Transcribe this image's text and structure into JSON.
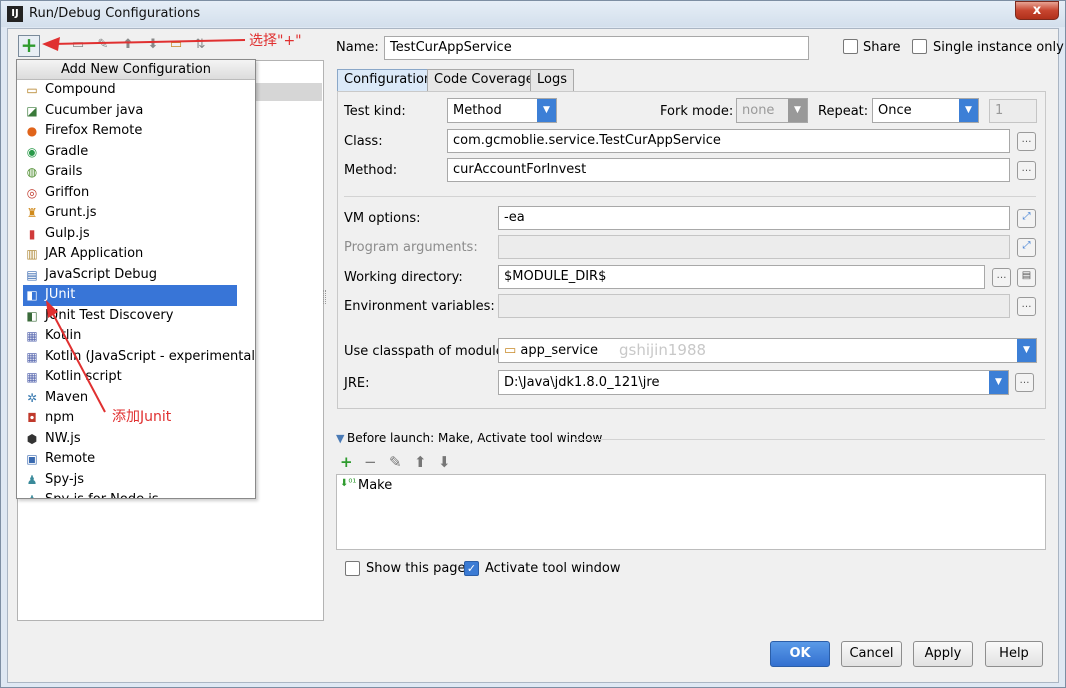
{
  "window": {
    "title": "Run/Debug Configurations",
    "close": "x",
    "logo": "IJ"
  },
  "toolbar": {
    "add": "+"
  },
  "popup": {
    "title": "Add New Configuration",
    "items": [
      {
        "label": "Compound",
        "icon": "compound-icon",
        "glyph": "▭",
        "color": "#b07b1c"
      },
      {
        "label": "Cucumber java",
        "icon": "cucumber-icon",
        "glyph": "◪",
        "color": "#3a7a3a"
      },
      {
        "label": "Firefox Remote",
        "icon": "firefox-icon",
        "glyph": "●",
        "color": "#e0641b"
      },
      {
        "label": "Gradle",
        "icon": "gradle-icon",
        "glyph": "◉",
        "color": "#2a9a4a"
      },
      {
        "label": "Grails",
        "icon": "grails-icon",
        "glyph": "◍",
        "color": "#4a8a2a"
      },
      {
        "label": "Griffon",
        "icon": "griffon-icon",
        "glyph": "◎",
        "color": "#c0392b"
      },
      {
        "label": "Grunt.js",
        "icon": "grunt-icon",
        "glyph": "♜",
        "color": "#d08a1c"
      },
      {
        "label": "Gulp.js",
        "icon": "gulp-icon",
        "glyph": "▮",
        "color": "#d03a3a"
      },
      {
        "label": "JAR Application",
        "icon": "jar-icon",
        "glyph": "▥",
        "color": "#b08a3a"
      },
      {
        "label": "JavaScript Debug",
        "icon": "js-debug-icon",
        "glyph": "▤",
        "color": "#3a6ab0"
      },
      {
        "label": "JUnit",
        "icon": "junit-icon",
        "glyph": "◧",
        "color": "#3a6a3a"
      },
      {
        "label": "JUnit Test Discovery",
        "icon": "junit-discovery-icon",
        "glyph": "◧",
        "color": "#3a6a3a"
      },
      {
        "label": "Kotlin",
        "icon": "kotlin-icon",
        "glyph": "▦",
        "color": "#5a6ab0"
      },
      {
        "label": "Kotlin (JavaScript - experimental)",
        "icon": "kotlin-js-icon",
        "glyph": "▦",
        "color": "#5a6ab0"
      },
      {
        "label": "Kotlin script",
        "icon": "kotlin-script-icon",
        "glyph": "▦",
        "color": "#5a6ab0"
      },
      {
        "label": "Maven",
        "icon": "maven-icon",
        "glyph": "✲",
        "color": "#3a7ab0"
      },
      {
        "label": "npm",
        "icon": "npm-icon",
        "glyph": "◘",
        "color": "#c0392b"
      },
      {
        "label": "NW.js",
        "icon": "nwjs-icon",
        "glyph": "⬢",
        "color": "#333333"
      },
      {
        "label": "Remote",
        "icon": "remote-icon",
        "glyph": "▣",
        "color": "#3a6ab0"
      },
      {
        "label": "Spy-js",
        "icon": "spyjs-icon",
        "glyph": "♟",
        "color": "#3a8a9a"
      },
      {
        "label": "Spy-js for Node.js",
        "icon": "spyjs-node-icon",
        "glyph": "♟",
        "color": "#3a8a9a"
      }
    ]
  },
  "annotations": {
    "select_plus": "选择\"+\"",
    "add_junit": "添加Junit",
    "accent": "#e03030"
  },
  "form": {
    "name_label": "Name:",
    "name_value": "TestCurAppService",
    "share": "Share",
    "single_instance": "Single instance only",
    "tabs": [
      "Configuration",
      "Code Coverage",
      "Logs"
    ],
    "test_kind_label": "Test kind:",
    "test_kind_value": "Method",
    "fork_mode_label": "Fork mode:",
    "fork_mode_value": "none",
    "repeat_label": "Repeat:",
    "repeat_value": "Once",
    "repeat_count": "1",
    "class_label": "Class:",
    "class_value": "com.gcmoblie.service.TestCurAppService",
    "method_label": "Method:",
    "method_value": "curAccountForInvest",
    "vm_label": "VM options:",
    "vm_value": "-ea",
    "program_args_label": "Program arguments:",
    "workdir_label": "Working directory:",
    "workdir_value": "$MODULE_DIR$",
    "env_label": "Environment variables:",
    "classpath_label": "Use classpath of module:",
    "classpath_value": "app_service",
    "jre_label": "JRE:",
    "jre_value": "D:\\Java\\jdk1.8.0_121\\jre",
    "before_launch": "Before launch: Make, Activate tool window",
    "make_item": "Make",
    "show_page": "Show this page",
    "activate_tool": "Activate tool window",
    "watermark": "gshijin1988"
  },
  "buttons": {
    "ok": "OK",
    "cancel": "Cancel",
    "apply": "Apply",
    "help": "Help"
  }
}
